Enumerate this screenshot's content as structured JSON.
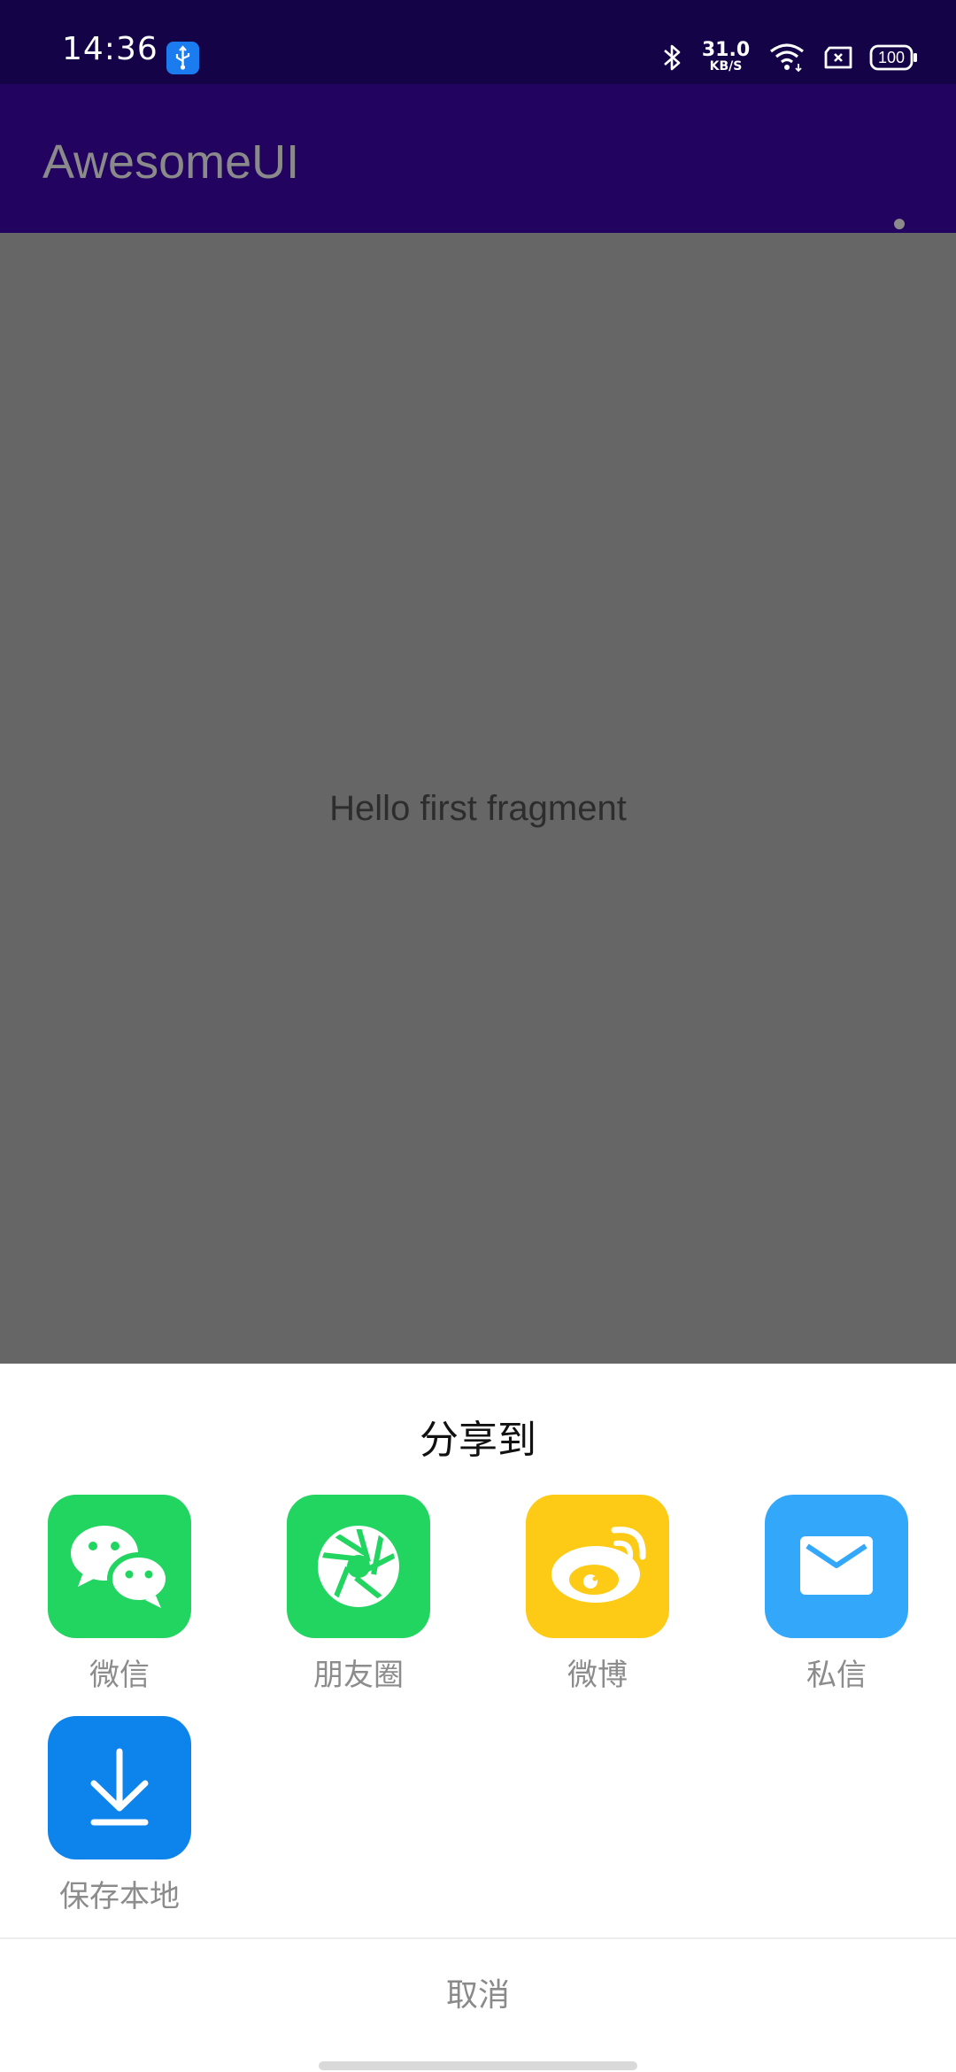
{
  "status_bar": {
    "time": "14:36",
    "net_speed_value": "31.0",
    "net_speed_unit": "KB/S",
    "battery": "100",
    "icons": [
      "usb-icon",
      "bluetooth-icon",
      "wifi-icon",
      "sim-icon",
      "battery-icon"
    ]
  },
  "app_bar": {
    "title": "AwesomeUI",
    "menu_icon": "more-vert-icon"
  },
  "content": {
    "text": "Hello first fragment"
  },
  "share_sheet": {
    "title": "分享到",
    "items": [
      {
        "label": "微信",
        "icon": "wechat-icon",
        "color": "#22d460"
      },
      {
        "label": "朋友圈",
        "icon": "moments-icon",
        "color": "#22d460"
      },
      {
        "label": "微博",
        "icon": "weibo-icon",
        "color": "#fdcb15"
      },
      {
        "label": "私信",
        "icon": "mail-icon",
        "color": "#33a8fb"
      },
      {
        "label": "保存本地",
        "icon": "download-icon",
        "color": "#0c84ec"
      }
    ],
    "cancel_label": "取消"
  },
  "colors": {
    "status_bar": "#140347",
    "app_bar": "#22035f",
    "dim_overlay": "#666666"
  }
}
